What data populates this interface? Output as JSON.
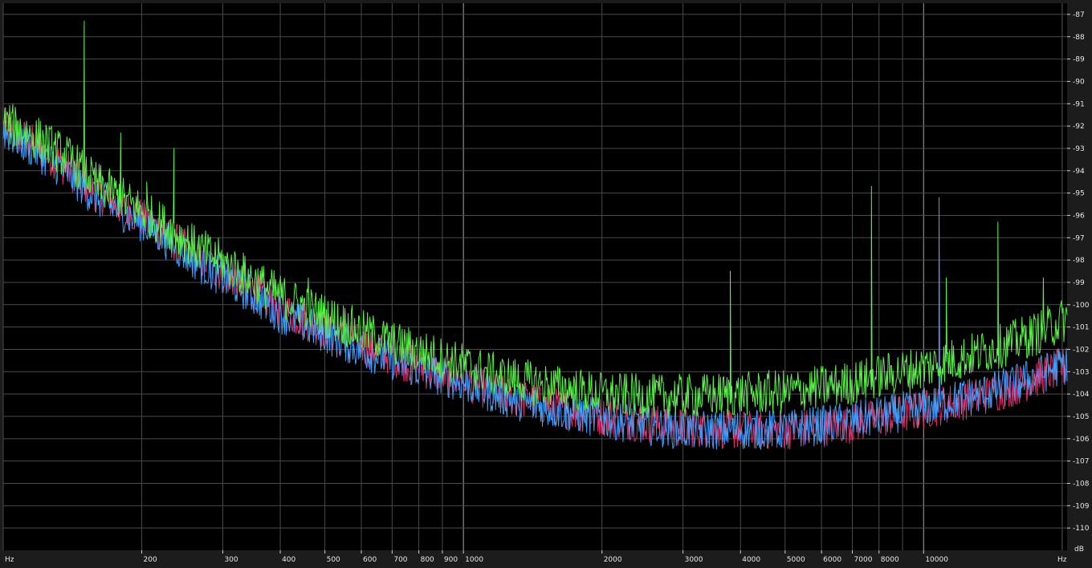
{
  "chart_data": {
    "type": "line",
    "title": "",
    "xlabel": "Hz",
    "xlabel_right": "Hz",
    "ylabel": "dB",
    "x_scale": "log",
    "xlim": [
      100,
      20500
    ],
    "ylim": [
      -111,
      -86.5
    ],
    "grid": true,
    "legend": "none",
    "background": "#000000",
    "grid_color": "#4a4a4a",
    "x_major_ticks": [
      1000,
      10000
    ],
    "x_tick_labels": [
      {
        "value": 200,
        "label": "200"
      },
      {
        "value": 300,
        "label": "300"
      },
      {
        "value": 400,
        "label": "400"
      },
      {
        "value": 500,
        "label": "500"
      },
      {
        "value": 600,
        "label": "600"
      },
      {
        "value": 700,
        "label": "700"
      },
      {
        "value": 800,
        "label": "800"
      },
      {
        "value": 900,
        "label": "900"
      },
      {
        "value": 1000,
        "label": "1000"
      },
      {
        "value": 2000,
        "label": "2000"
      },
      {
        "value": 3000,
        "label": "3000"
      },
      {
        "value": 4000,
        "label": "4000"
      },
      {
        "value": 5000,
        "label": "5000"
      },
      {
        "value": 6000,
        "label": "6000"
      },
      {
        "value": 7000,
        "label": "7000"
      },
      {
        "value": 8000,
        "label": "8000"
      },
      {
        "value": 10000,
        "label": "10000"
      }
    ],
    "y_ticks": [
      -87,
      -88,
      -89,
      -90,
      -91,
      -92,
      -93,
      -94,
      -95,
      -96,
      -97,
      -98,
      -99,
      -100,
      -101,
      -102,
      -103,
      -104,
      -105,
      -106,
      -107,
      -108,
      -109,
      -110
    ],
    "series": [
      {
        "color": "#e0306a",
        "noise": 0.9,
        "x": [
          100,
          120,
          140,
          150,
          160,
          180,
          200,
          230,
          260,
          300,
          350,
          400,
          500,
          600,
          700,
          800,
          1000,
          1200,
          1500,
          2000,
          2500,
          3000,
          4000,
          5000,
          6000,
          7000,
          8000,
          9000,
          10000,
          12000,
          14000,
          16000,
          18000,
          20000
        ],
        "y": [
          -92.0,
          -93.0,
          -94.0,
          -94.6,
          -95.0,
          -95.6,
          -96.1,
          -97.0,
          -97.8,
          -98.6,
          -99.4,
          -100.2,
          -101.1,
          -101.8,
          -102.3,
          -102.8,
          -103.4,
          -104.0,
          -104.5,
          -105.0,
          -105.3,
          -105.5,
          -105.6,
          -105.6,
          -105.5,
          -105.3,
          -105.1,
          -104.9,
          -104.7,
          -104.3,
          -104.0,
          -103.6,
          -103.2,
          -102.8
        ],
        "spikes": [
          {
            "x": 150,
            "y": -92.0
          },
          {
            "x": 10800,
            "y": -96.5
          }
        ]
      },
      {
        "color": "#3ea0ff",
        "noise": 0.9,
        "x": [
          100,
          120,
          140,
          150,
          160,
          180,
          200,
          230,
          260,
          300,
          350,
          400,
          500,
          600,
          700,
          800,
          1000,
          1200,
          1500,
          2000,
          2500,
          3000,
          4000,
          5000,
          6000,
          7000,
          8000,
          9000,
          10000,
          12000,
          14000,
          16000,
          18000,
          20000
        ],
        "y": [
          -92.2,
          -93.2,
          -94.2,
          -94.8,
          -95.2,
          -95.8,
          -96.3,
          -97.2,
          -98.0,
          -98.8,
          -99.6,
          -100.4,
          -101.3,
          -102.0,
          -102.5,
          -102.9,
          -103.5,
          -104.1,
          -104.6,
          -105.1,
          -105.4,
          -105.6,
          -105.6,
          -105.6,
          -105.4,
          -105.2,
          -105.0,
          -104.8,
          -104.6,
          -104.2,
          -103.9,
          -103.5,
          -103.1,
          -102.7
        ],
        "spikes": [
          {
            "x": 180,
            "y": -93.0
          },
          {
            "x": 10800,
            "y": -95.2
          }
        ]
      },
      {
        "color": "#5cf04a",
        "noise": 1.0,
        "x": [
          100,
          120,
          140,
          150,
          160,
          180,
          200,
          230,
          260,
          300,
          350,
          400,
          500,
          600,
          700,
          800,
          1000,
          1200,
          1500,
          2000,
          2500,
          3000,
          4000,
          5000,
          6000,
          7000,
          8000,
          9000,
          10000,
          12000,
          14000,
          16000,
          18000,
          20000
        ],
        "y": [
          -91.8,
          -92.6,
          -93.5,
          -94.1,
          -94.6,
          -95.2,
          -95.8,
          -96.6,
          -97.4,
          -98.1,
          -98.9,
          -99.6,
          -100.5,
          -101.2,
          -101.7,
          -102.1,
          -102.7,
          -103.2,
          -103.6,
          -104.0,
          -104.1,
          -104.1,
          -104.0,
          -103.9,
          -103.7,
          -103.5,
          -103.2,
          -103.0,
          -102.8,
          -102.4,
          -102.0,
          -101.6,
          -101.2,
          -100.7
        ],
        "spikes": [
          {
            "x": 150,
            "y": -87.3
          },
          {
            "x": 180,
            "y": -92.3
          },
          {
            "x": 205,
            "y": -94.5
          },
          {
            "x": 235,
            "y": -93.0
          },
          {
            "x": 460,
            "y": -98.8
          },
          {
            "x": 3800,
            "y": -98.5
          },
          {
            "x": 7700,
            "y": -94.7
          },
          {
            "x": 11200,
            "y": -98.8
          },
          {
            "x": 14500,
            "y": -96.3
          },
          {
            "x": 18200,
            "y": -98.8
          }
        ]
      }
    ]
  }
}
